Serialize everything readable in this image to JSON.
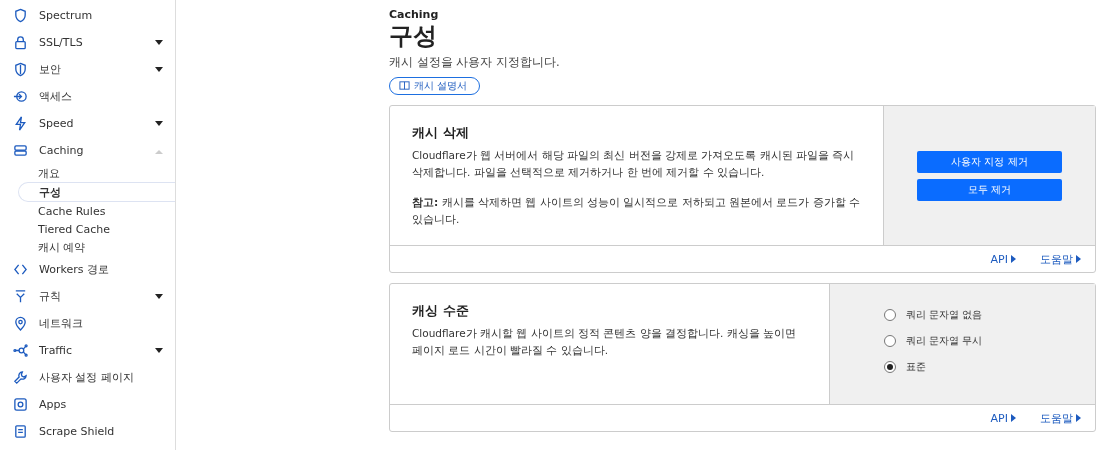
{
  "sidebar": {
    "items": [
      {
        "label": "Spectrum"
      },
      {
        "label": "SSL/TLS",
        "expanded": false
      },
      {
        "label": "보안",
        "expanded": false
      },
      {
        "label": "액세스"
      },
      {
        "label": "Speed",
        "expanded": false
      },
      {
        "label": "Caching",
        "expanded": true,
        "children": [
          {
            "label": "개요",
            "selected": false
          },
          {
            "label": "구성",
            "selected": true
          },
          {
            "label": "Cache Rules",
            "selected": false
          },
          {
            "label": "Tiered Cache",
            "selected": false
          },
          {
            "label": "캐시 예약",
            "selected": false
          }
        ]
      },
      {
        "label": "Workers 경로"
      },
      {
        "label": "규칙",
        "expanded": false
      },
      {
        "label": "네트워크"
      },
      {
        "label": "Traffic",
        "expanded": false
      },
      {
        "label": "사용자 설정 페이지"
      },
      {
        "label": "Apps"
      },
      {
        "label": "Scrape Shield"
      }
    ]
  },
  "header": {
    "breadcrumb": "Caching",
    "title": "구성",
    "subtitle": "캐시 설정을 사용자 지정합니다.",
    "doc_link": "캐시 설명서"
  },
  "cards": [
    {
      "title": "캐시 삭제",
      "kind": "buttons",
      "paragraphs": [
        "Cloudflare가 웹 서버에서 해당 파일의 최신 버전을 강제로 가져오도록 캐시된 파일을 즉시 삭제합니다. 파일을 선택적으로 제거하거나 한 번에 제거할 수 있습니다.",
        "**참고:** 캐시를 삭제하면 웹 사이트의 성능이 일시적으로 저하되고 원본에서 로드가 증가할 수 있습니다."
      ],
      "buttons": [
        "사용자 지정 제거",
        "모두 제거"
      ],
      "links": [
        "API",
        "도움말"
      ]
    },
    {
      "title": "캐싱 수준",
      "kind": "radios",
      "paragraphs": [
        "Cloudflare가 캐시할 웹 사이트의 정적 콘텐츠 양을 결정합니다. 캐싱을 높이면 페이지 로드 시간이 빨라질 수 있습니다."
      ],
      "options": [
        {
          "label": "쿼리 문자열 없음",
          "selected": false
        },
        {
          "label": "쿼리 문자열 무시",
          "selected": false
        },
        {
          "label": "표준",
          "selected": true
        }
      ],
      "links": [
        "API",
        "도움말"
      ]
    }
  ]
}
